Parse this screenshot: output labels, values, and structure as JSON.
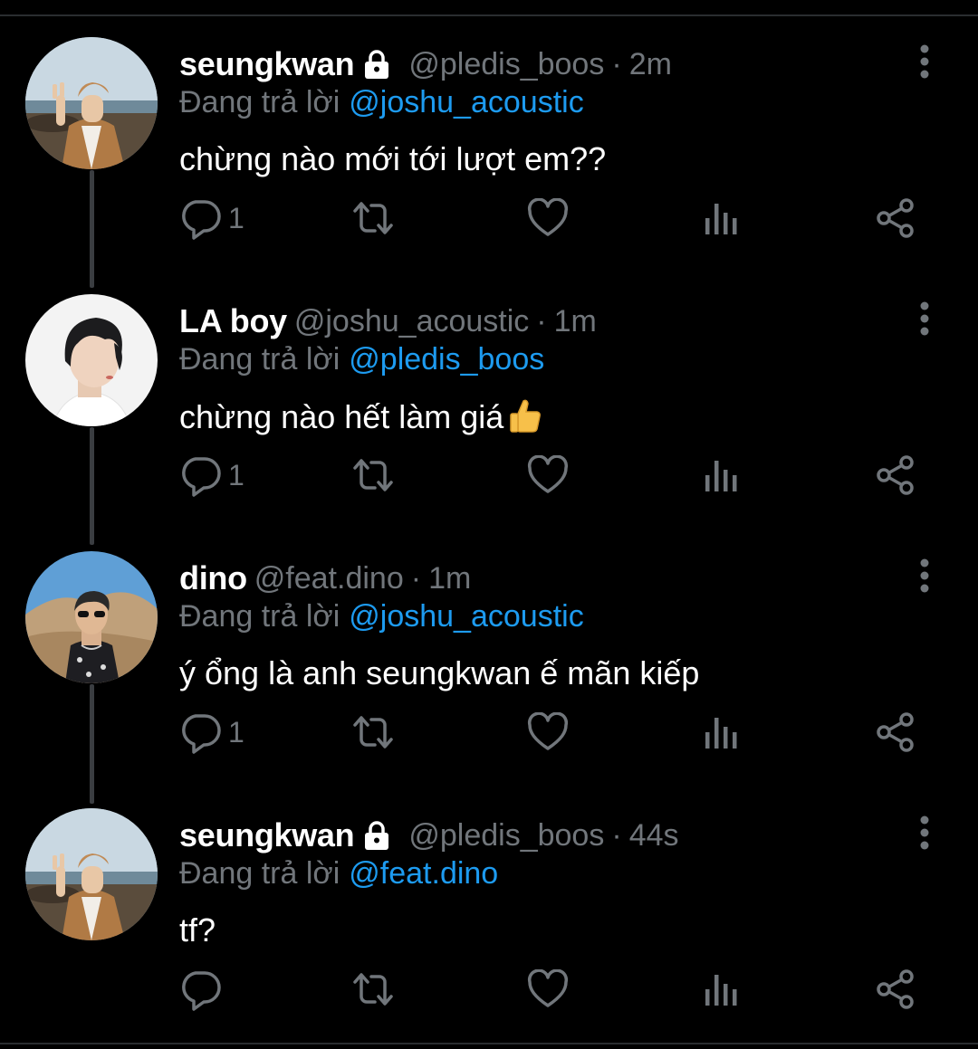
{
  "thread": [
    {
      "name": "seungkwan",
      "locked": true,
      "handle": "@pledis_boos",
      "separator": "·",
      "time": "2m",
      "reply_prefix": "Đang trả lời",
      "reply_to": "@joshu_acoustic",
      "text": "chừng nào mới tới lượt em??",
      "emoji": "",
      "reply_count": "1"
    },
    {
      "name": "LA boy",
      "locked": false,
      "handle": "@joshu_acoustic",
      "separator": "·",
      "time": "1m",
      "reply_prefix": "Đang trả lời",
      "reply_to": "@pledis_boos",
      "text": "chừng nào hết làm giá",
      "emoji": "👍",
      "reply_count": "1"
    },
    {
      "name": "dino",
      "locked": false,
      "handle": "@feat.dino",
      "separator": "·",
      "time": "1m",
      "reply_prefix": "Đang trả lời",
      "reply_to": "@joshu_acoustic",
      "text": "ý ổng là anh seungkwan ế mãn kiếp",
      "emoji": "",
      "reply_count": "1"
    },
    {
      "name": "seungkwan",
      "locked": true,
      "handle": "@pledis_boos",
      "separator": "·",
      "time": "44s",
      "reply_prefix": "Đang trả lời",
      "reply_to": "@feat.dino",
      "text": "tf?",
      "emoji": "",
      "reply_count": ""
    }
  ],
  "icons": {
    "reply": "reply-icon",
    "retweet": "retweet-icon",
    "like": "heart-icon",
    "views": "views-icon",
    "share": "share-icon",
    "menu": "more-vertical-icon",
    "lock": "lock-icon"
  },
  "colors": {
    "background": "#000000",
    "primary_text": "#ffffff",
    "secondary_text": "#71767b",
    "mention": "#1d9bf0",
    "thread_line": "#3a3d41"
  }
}
